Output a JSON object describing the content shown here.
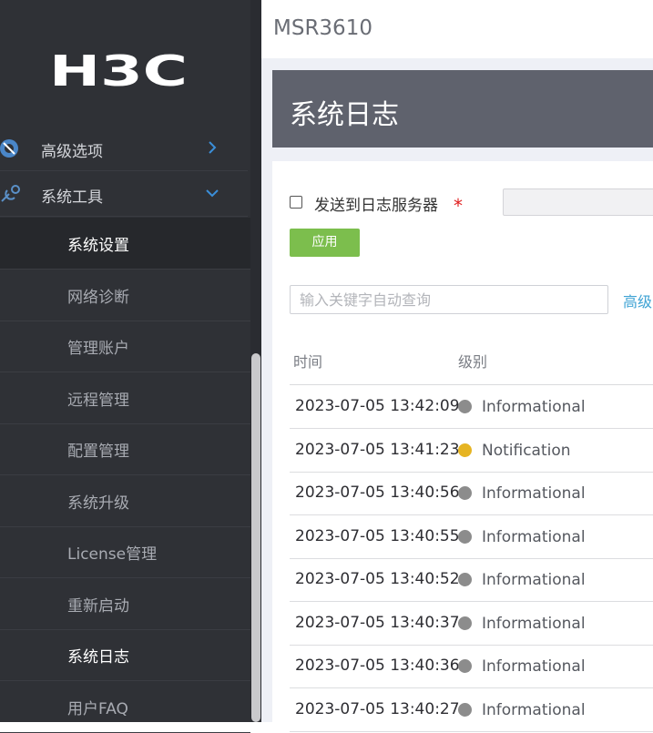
{
  "sidebar": {
    "logo_text": "H3C",
    "groups": [
      {
        "label": "高级选项",
        "icon": "advanced-options-icon",
        "expanded": false
      },
      {
        "label": "系统工具",
        "icon": "system-tools-icon",
        "expanded": true
      }
    ],
    "items": [
      {
        "label": "系统设置"
      },
      {
        "label": "网络诊断"
      },
      {
        "label": "管理账户"
      },
      {
        "label": "远程管理"
      },
      {
        "label": "配置管理"
      },
      {
        "label": "系统升级"
      },
      {
        "label": "License管理"
      },
      {
        "label": "重新启动"
      },
      {
        "label": "系统日志"
      },
      {
        "label": "用户FAQ"
      }
    ]
  },
  "header": {
    "device_name": "MSR3610"
  },
  "page": {
    "title": "系统日志"
  },
  "form": {
    "send_checkbox_label": "发送到日志服务器",
    "send_checked": false,
    "required_mark": "*",
    "server_value": "",
    "apply_label": "应用"
  },
  "search": {
    "placeholder": "输入关键字自动查询",
    "value": "",
    "advanced_label": "高级"
  },
  "table": {
    "columns": [
      "时间",
      "级别"
    ],
    "rows": [
      {
        "time": "2023-07-05 13:42:09",
        "level": "Informational",
        "color": "#8c8c8c"
      },
      {
        "time": "2023-07-05 13:41:23",
        "level": "Notification",
        "color": "#e6b422"
      },
      {
        "time": "2023-07-05 13:40:56",
        "level": "Informational",
        "color": "#8c8c8c"
      },
      {
        "time": "2023-07-05 13:40:55",
        "level": "Informational",
        "color": "#8c8c8c"
      },
      {
        "time": "2023-07-05 13:40:52",
        "level": "Informational",
        "color": "#8c8c8c"
      },
      {
        "time": "2023-07-05 13:40:37",
        "level": "Informational",
        "color": "#8c8c8c"
      },
      {
        "time": "2023-07-05 13:40:36",
        "level": "Informational",
        "color": "#8c8c8c"
      },
      {
        "time": "2023-07-05 13:40:27",
        "level": "Informational",
        "color": "#8c8c8c"
      }
    ]
  },
  "colors": {
    "sidebar_bg": "#2f3136",
    "header_bg": "#5f626d",
    "accent_green": "#7cbe4d",
    "link_blue": "#3fa3d4",
    "chevron_blue": "#3b8fd9"
  }
}
